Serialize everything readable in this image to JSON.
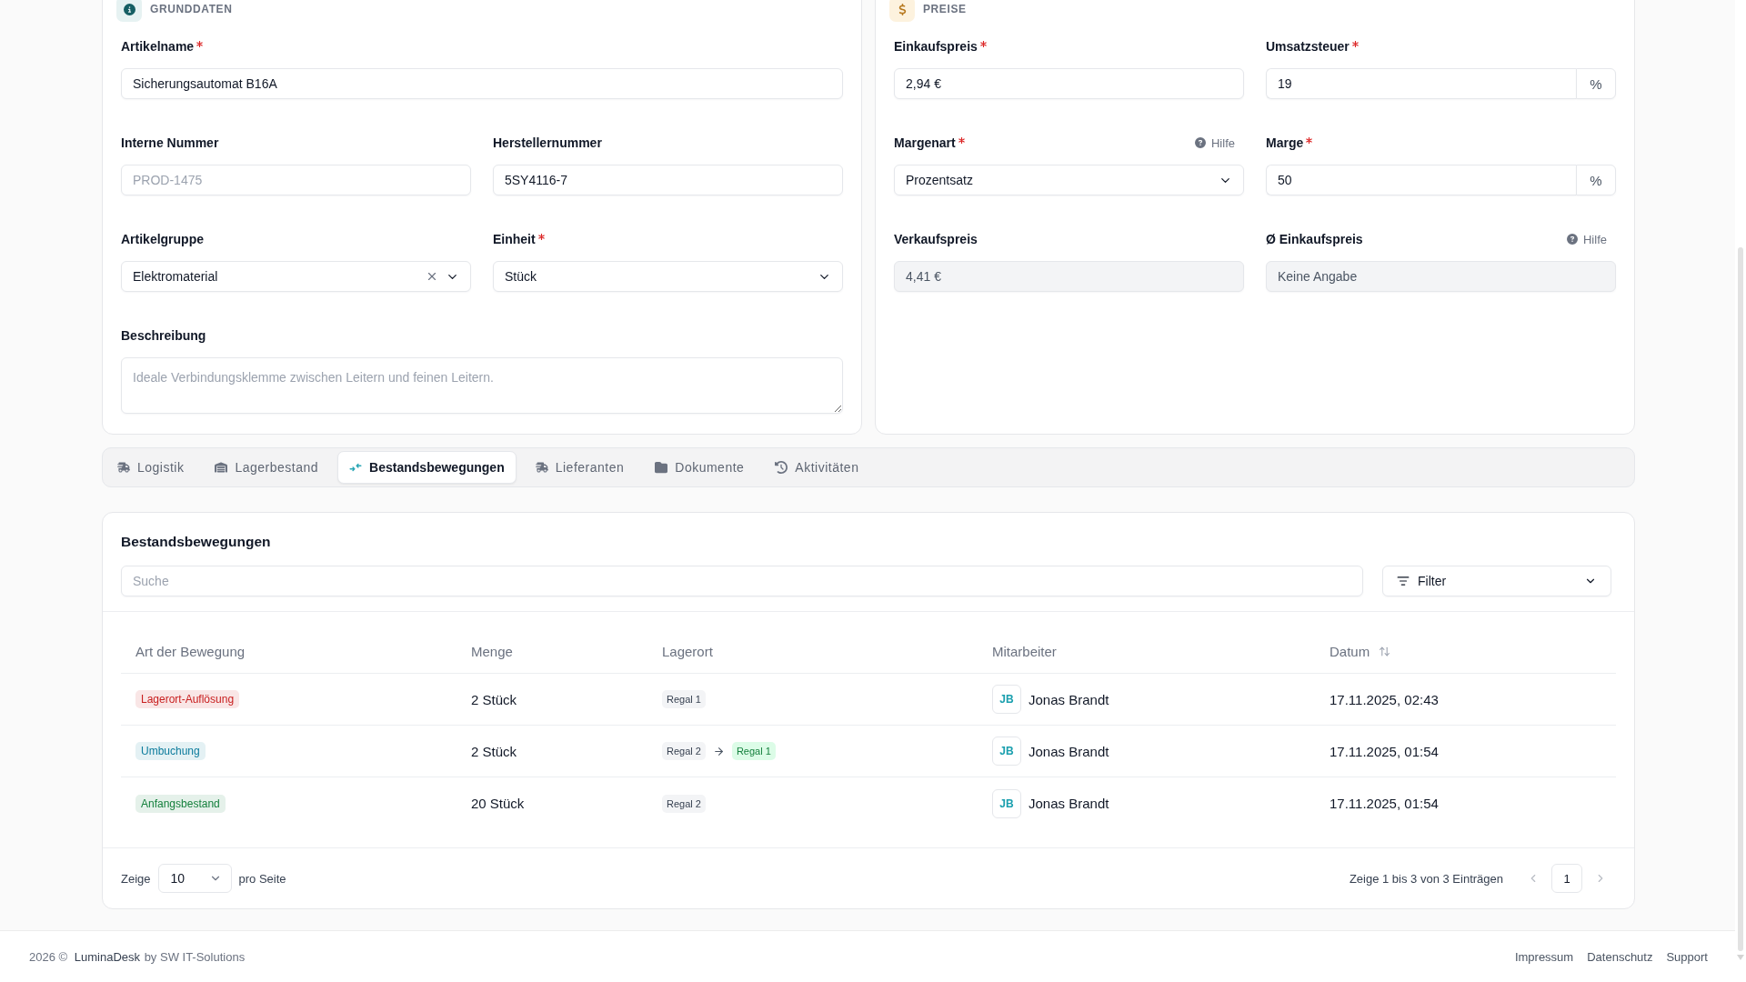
{
  "basic_data": {
    "title": "GRUNDDATEN",
    "rows": [
      {
        "fields": [
          {
            "label": "Artikelname",
            "required": true,
            "kind": "text",
            "value": "Sicherungsautomat B16A",
            "disabled": false
          }
        ]
      },
      {
        "fields": [
          {
            "label": "Interne Nummer",
            "required": false,
            "kind": "text",
            "placeholder": "PROD-1475",
            "disabled": false
          },
          {
            "label": "Herstellernummer",
            "required": false,
            "kind": "text",
            "value": "5SY4116-7",
            "disabled": false
          }
        ]
      },
      {
        "fields": [
          {
            "label": "Artikelgruppe",
            "required": false,
            "kind": "select",
            "value": "Elektromaterial",
            "clearable": true,
            "disabled": false
          },
          {
            "label": "Einheit",
            "required": true,
            "kind": "select",
            "value": "Stück",
            "clearable": false,
            "disabled": false
          }
        ]
      },
      {
        "fields": [
          {
            "label": "Beschreibung",
            "required": false,
            "kind": "textarea",
            "placeholder": "Ideale Verbindungsklemme zwischen Leitern und feinen Leitern.",
            "disabled": false
          }
        ]
      }
    ]
  },
  "prices": {
    "title": "PREISE",
    "rows": [
      {
        "fields": [
          {
            "label": "Einkaufspreis",
            "required": true,
            "kind": "text",
            "value": "2,94 €",
            "disabled": false
          },
          {
            "label": "Umsatzsteuer",
            "required": true,
            "kind": "text",
            "value": "19",
            "suffix": "%",
            "disabled": false
          }
        ]
      },
      {
        "fields": [
          {
            "label": "Margenart",
            "required": true,
            "help": "Hilfe",
            "kind": "select",
            "value": "Prozentsatz",
            "clearable": false,
            "disabled": false
          },
          {
            "label": "Marge",
            "required": true,
            "kind": "text",
            "value": "50",
            "suffix": "%",
            "disabled": false
          }
        ]
      },
      {
        "fields": [
          {
            "label": "Verkaufspreis",
            "required": false,
            "kind": "text",
            "value": "4,41 €",
            "disabled": true
          },
          {
            "label": "Ø Einkaufspreis",
            "required": false,
            "help": "Hilfe",
            "kind": "text",
            "value": "Keine Angabe",
            "disabled": true
          }
        ]
      }
    ]
  },
  "tabs": [
    {
      "label": "Logistik",
      "selected": false
    },
    {
      "label": "Lagerbestand",
      "selected": false
    },
    {
      "label": "Bestandsbewegungen",
      "selected": true
    },
    {
      "label": "Lieferanten",
      "selected": false
    },
    {
      "label": "Dokumente",
      "selected": false
    },
    {
      "label": "Aktivitäten",
      "selected": false
    }
  ],
  "movements": {
    "title": "Bestandsbewegungen",
    "search": {
      "placeholder": "Suche"
    },
    "filter": {
      "label": "Filter"
    },
    "table": {
      "columns": [
        {
          "label": "Art der Bewegung",
          "sortable": false
        },
        {
          "label": "Menge",
          "sortable": false
        },
        {
          "label": "Lagerort",
          "sortable": false
        },
        {
          "label": "Mitarbeiter",
          "sortable": false
        },
        {
          "label": "Datum",
          "sortable": true
        }
      ],
      "rows": [
        {
          "type": {
            "label": "Lagerort-Auflösung",
            "color": "#c81e1e"
          },
          "quantity": "2 Stück",
          "storage": {
            "from": "Regal 1"
          },
          "employee": {
            "initials": "JB",
            "name": "Jonas Brandt"
          },
          "date": "17.11.2025, 02:43"
        },
        {
          "type": {
            "label": "Umbuchung",
            "color": "#0b7b9c"
          },
          "quantity": "2 Stück",
          "storage": {
            "from": "Regal 2",
            "to": "Regal 1"
          },
          "employee": {
            "initials": "JB",
            "name": "Jonas Brandt"
          },
          "date": "17.11.2025, 01:54"
        },
        {
          "type": {
            "label": "Anfangsbestand",
            "color": "#15803d"
          },
          "quantity": "20 Stück",
          "storage": {
            "from": "Regal 2"
          },
          "employee": {
            "initials": "JB",
            "name": "Jonas Brandt"
          },
          "date": "17.11.2025, 01:54"
        }
      ]
    },
    "pagination": {
      "show_label": "Zeige",
      "page_size": "10",
      "per_page_label": "pro Seite",
      "summary": "Zeige 1 bis 3 von 3 Einträgen",
      "previous": {
        "disabled": true
      },
      "next": {
        "disabled": true
      },
      "pages": [
        {
          "label": "1",
          "selected": true
        }
      ]
    }
  },
  "footer": {
    "copyright": "2026 ©",
    "brand": "LuminaDesk",
    "credit": "by SW IT-Solutions",
    "links": [
      "Impressum",
      "Datenschutz",
      "Support"
    ]
  }
}
